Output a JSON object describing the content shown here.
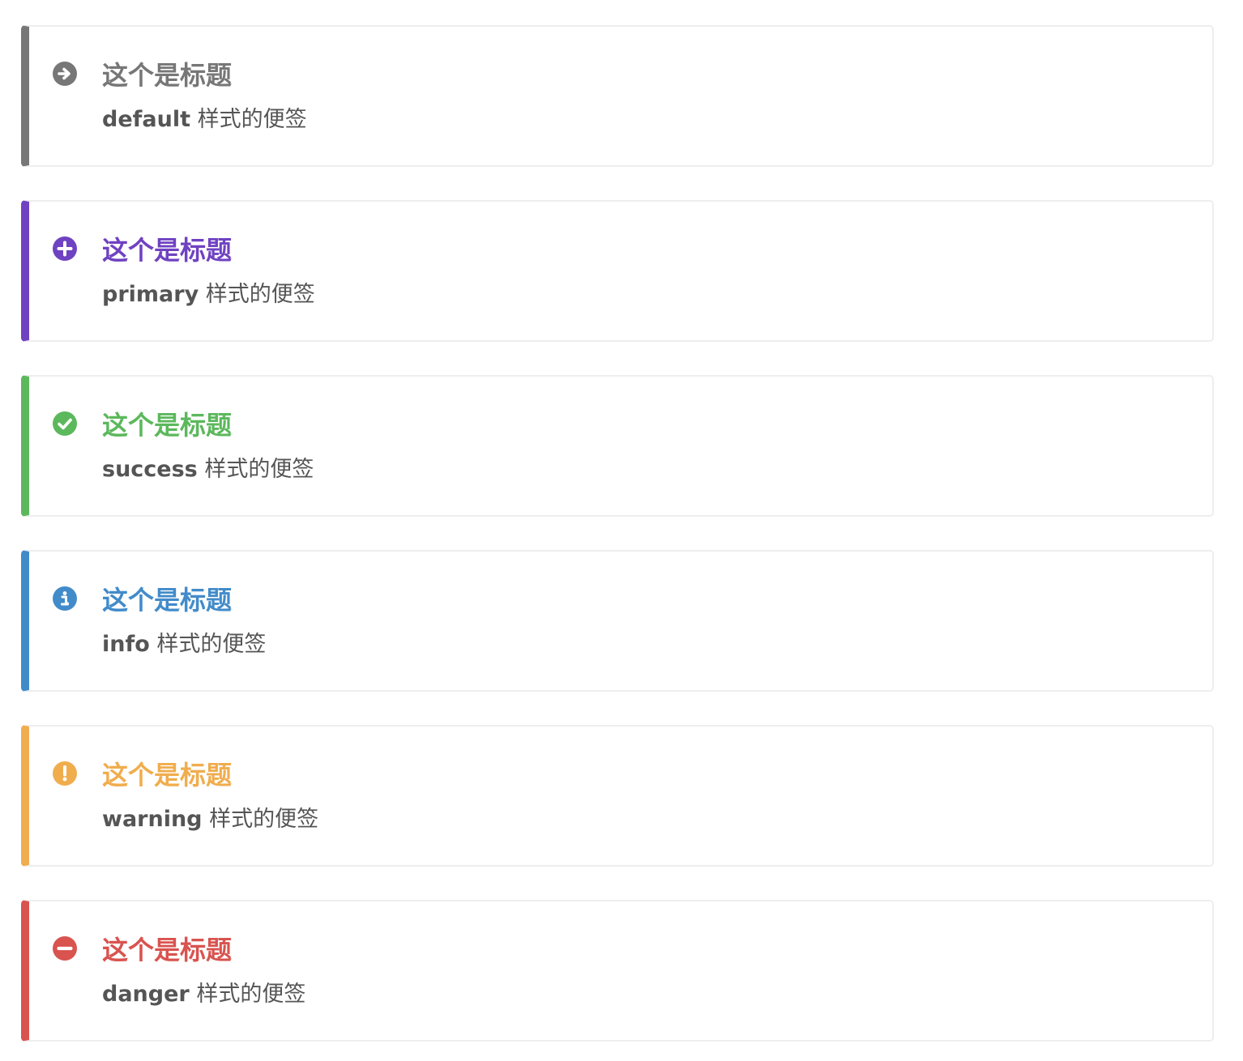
{
  "notes": [
    {
      "type": "default",
      "icon": "arrow-circle-right-icon",
      "color": "#777777",
      "title": "这个是标题",
      "keyword": "default",
      "text": " 样式的便签"
    },
    {
      "type": "primary",
      "icon": "plus-circle-icon",
      "color": "#6f42c1",
      "title": "这个是标题",
      "keyword": "primary",
      "text": " 样式的便签"
    },
    {
      "type": "success",
      "icon": "check-circle-icon",
      "color": "#5cb85c",
      "title": "这个是标题",
      "keyword": "success",
      "text": " 样式的便签"
    },
    {
      "type": "info",
      "icon": "info-circle-icon",
      "color": "#428bca",
      "title": "这个是标题",
      "keyword": "info",
      "text": " 样式的便签"
    },
    {
      "type": "warning",
      "icon": "exclamation-circle-icon",
      "color": "#f0ad4e",
      "title": "这个是标题",
      "keyword": "warning",
      "text": " 样式的便签"
    },
    {
      "type": "danger",
      "icon": "minus-circle-icon",
      "color": "#d9534f",
      "title": "这个是标题",
      "keyword": "danger",
      "text": " 样式的便签"
    }
  ]
}
